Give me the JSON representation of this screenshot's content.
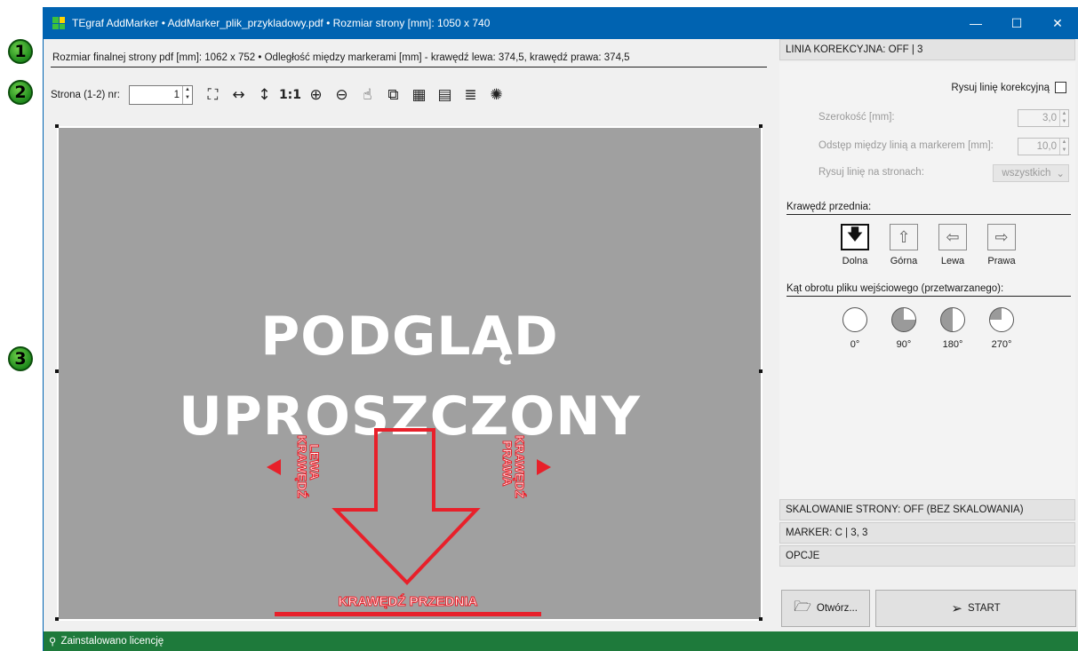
{
  "callouts": [
    "1",
    "2",
    "3"
  ],
  "window": {
    "title": "TEgraf AddMarker • AddMarker_plik_przykladowy.pdf • Rozmiar strony [mm]: 1050 x 740",
    "minimize": "—",
    "maximize": "☐",
    "close": "✕"
  },
  "info_bar": "Rozmiar finalnej strony pdf [mm]: 1062 x 752 • Odległość między markerami [mm] - krawędź lewa: 374,5, krawędź prawa: 374,5",
  "toolbar": {
    "page_label": "Strona (1-2) nr:",
    "page_value": "1",
    "icons": [
      "fit-page-icon",
      "fit-width-icon",
      "fit-height-icon",
      "actual-size-icon",
      "zoom-in-icon",
      "zoom-out-icon",
      "hand-tool-icon",
      "search-page-icon",
      "grid-icon",
      "list-icon",
      "text-info-icon",
      "preview-mode-icon"
    ],
    "actual_size_label": "1:1"
  },
  "preview": {
    "line1": "PODGLĄD",
    "line2": "UPROSZCZONY",
    "left_edge_line1": "KRAWĘDŹ",
    "left_edge_line2": "LEWA",
    "right_edge_line1": "KRAWĘDŹ",
    "right_edge_line2": "PRAWA",
    "front_edge": "KRAWĘDŹ PRZEDNIA",
    "accent_color": "#e8202a"
  },
  "right_panel": {
    "section_correction": "LINIA KOREKCYJNA: OFF | 3",
    "draw_line_label": "Rysuj linię korekcyjną",
    "draw_line_checked": false,
    "width_label": "Szerokość [mm]:",
    "width_value": "3,0",
    "gap_label": "Odstęp między linią a markerem [mm]:",
    "gap_value": "10,0",
    "pages_label": "Rysuj linię na stronach:",
    "pages_value": "wszystkich",
    "front_edge_label": "Krawędź przednia:",
    "edges": [
      {
        "label": "Dolna",
        "icon": "arrow-down-icon",
        "glyph": "🡇",
        "selected": true
      },
      {
        "label": "Górna",
        "icon": "arrow-up-icon",
        "glyph": "⇧",
        "selected": false
      },
      {
        "label": "Lewa",
        "icon": "arrow-left-icon",
        "glyph": "⇦",
        "selected": false
      },
      {
        "label": "Prawa",
        "icon": "arrow-right-icon",
        "glyph": "⇨",
        "selected": false
      }
    ],
    "rotation_label": "Kąt obrotu pliku wejściowego (przetwarzanego):",
    "rotations": [
      "0°",
      "90°",
      "180°",
      "270°"
    ],
    "section_scaling": "SKALOWANIE STRONY: OFF (BEZ SKALOWANIA)",
    "section_marker": "MARKER: C | 3, 3",
    "section_options": "OPCJE",
    "open_button": "Otwórz...",
    "start_button": "START"
  },
  "status": "Zainstalowano licencję"
}
